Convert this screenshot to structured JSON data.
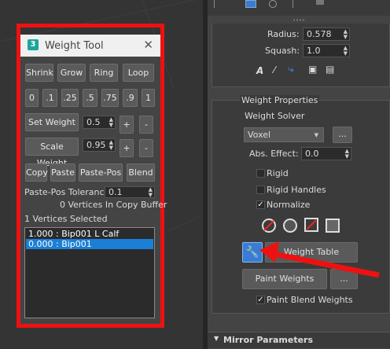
{
  "weight_tool": {
    "title": "Weight Tool",
    "logo": "3",
    "close": "✕",
    "row1": [
      "Shrink",
      "Grow",
      "Ring",
      "Loop"
    ],
    "row2": [
      "0",
      ".1",
      ".25",
      ".5",
      ".75",
      ".9",
      "1"
    ],
    "set_weight_label": "Set Weight",
    "set_weight_value": "0.5",
    "scale_weight_label": "Scale Weight",
    "scale_weight_value": "0.95",
    "plus": "+",
    "minus": "-",
    "row_copy": [
      "Copy",
      "Paste",
      "Paste-Pos",
      "Blend"
    ],
    "paste_pos_tolerance_label": "Paste-Pos Tolerance",
    "paste_pos_tolerance_value": "0.1",
    "copy_buffer_status": "0 Vertices In Copy Buffer",
    "vertices_selected": "1 Vertices Selected",
    "list": [
      {
        "text": "1.000 : Bip001 L Calf",
        "selected": false
      },
      {
        "text": "0.000 : Bip001",
        "selected": true
      }
    ]
  },
  "command_panel": {
    "radius_label": "Radius:",
    "radius_value": "0.578",
    "squash_label": "Squash:",
    "squash_value": "1.0",
    "weight_properties_title": "Weight Properties",
    "weight_solver_label": "Weight Solver",
    "solver_value": "Voxel",
    "solver_more": "...",
    "abs_effect_label": "Abs. Effect:",
    "abs_effect_value": "0.0",
    "rigid_label": "Rigid",
    "rigid_handles_label": "Rigid Handles",
    "normalize_label": "Normalize",
    "normalize_checked": "✓",
    "weight_table_label": "Weight Table",
    "paint_weights_label": "Paint Weights",
    "paint_more": "...",
    "paint_blend_label": "Paint Blend Weights",
    "paint_blend_checked": "✓",
    "mirror_parameters_label": "Mirror Parameters"
  },
  "colors": {
    "highlight_red": "#ee1111",
    "selection_blue": "#1b7fd6",
    "accent_blue": "#3a7bd5"
  }
}
